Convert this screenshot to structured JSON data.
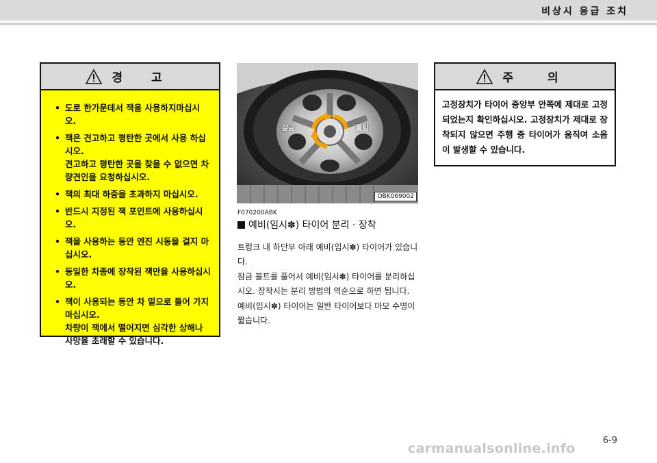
{
  "header": {
    "title": "비상시 응급 조치"
  },
  "warning": {
    "title": "경 고",
    "items": [
      "도로 한가운데서 잭을 사용하지마십시오.",
      "잭은 견고하고 평탄한 곳에서 사용 하십시오.",
      "견고하고 평탄한 곳을 찾을 수 없으면 차량견인을 요청하십시오.",
      "잭의 최대 하중을 초과하지 마십시오.",
      "반드시 지정된 잭 포인트에 사용하십시오.",
      "잭을 사용하는 동안 엔진 시동을 걸지 마십시오.",
      "동일한 차종에 장착된 잭만을 사용하십시오.",
      "잭이 사용되는 동안 차 밑으로 들어 가지 마십시오.",
      "차량이 잭에서 떨어지면 심각한 상해나 사망을 초래할 수 있습니다."
    ]
  },
  "photo": {
    "code": "OBK069002",
    "label_tighten": "잠금",
    "label_loosen": "풀림"
  },
  "section": {
    "figure_id": "F070200ABK",
    "title": "예비(임시✽) 타이어 분리 · 장착",
    "paragraphs": [
      "트렁크 내 하단부 아래 예비(임시✽) 타이어가 있습니다.",
      "잠금 볼트를 풀어서 예비(임시✽) 타이어를 분리하십시오. 장착시는 분리 방법의 역순으로 하면 됩니다.",
      "예비(임시✽) 타이어는 일반 타이어보다 마모 수명이 짧습니다."
    ]
  },
  "caution": {
    "title": "주 의",
    "body": "고정장치가 타이어 중앙부 안쪽에 제대로 고정되었는지 확인하십시오. 고정장치가 제대로 장착되지 않으면 주행 중 타이어가 움직여 소음이 발생할 수 있습니다."
  },
  "page_number": "6-9",
  "watermark": "carmanualsonline.info",
  "colors": {
    "warning_bg": "#ffff00",
    "head_bg": "#d9d9d9",
    "arrow": "#f5a000"
  },
  "icons": [
    "warning-triangle-icon"
  ]
}
